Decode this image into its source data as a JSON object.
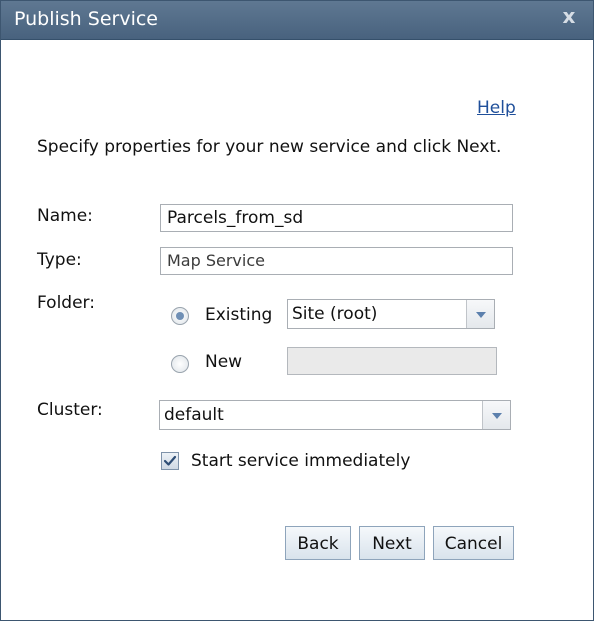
{
  "dialog": {
    "title": "Publish Service",
    "close_label": "x",
    "help_link": "Help",
    "instructions": "Specify properties for your new service and click Next."
  },
  "form": {
    "name_label": "Name:",
    "name_value": "Parcels_from_sd",
    "type_label": "Type:",
    "type_value": "Map Service",
    "folder_label": "Folder:",
    "folder_existing_label": "Existing",
    "folder_existing_selected": true,
    "folder_existing_value": "Site (root)",
    "folder_new_label": "New",
    "folder_new_value": "",
    "cluster_label": "Cluster:",
    "cluster_value": "default",
    "start_immediately_label": "Start service immediately",
    "start_immediately_checked": true
  },
  "buttons": {
    "back": "Back",
    "next": "Next",
    "cancel": "Cancel"
  },
  "colors": {
    "titlebar": "#55708c",
    "link": "#1f4f9a",
    "button_border": "#8ea4bb"
  }
}
